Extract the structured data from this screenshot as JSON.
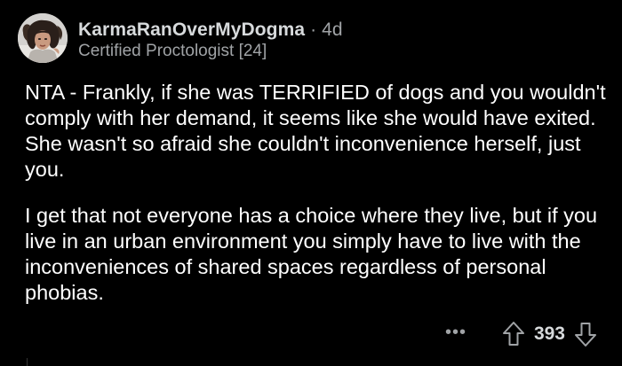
{
  "comment": {
    "username": "KarmaRanOverMyDogma",
    "separator": "·",
    "age": "4d",
    "flair": "Certified Proctologist [24]",
    "paragraphs": [
      "NTA - Frankly, if she was TERRIFIED of dogs and you wouldn't comply with her demand, it seems like she would have exited. She wasn't so afraid she couldn't inconvenience herself, just you.",
      "I get that not everyone has a choice where they live, but if you live in an urban environment you simply have to live with the inconveniences of shared spaces regardless of personal phobias."
    ],
    "more_label": "•••",
    "score": "393"
  },
  "icons": {
    "avatar": "user-avatar",
    "upvote": "upvote-arrow-icon",
    "downvote": "downvote-arrow-icon",
    "more": "more-options-icon"
  },
  "colors": {
    "background": "#000000",
    "text": "#ffffff",
    "username": "#d7dadc",
    "meta": "#a0a3a6"
  }
}
